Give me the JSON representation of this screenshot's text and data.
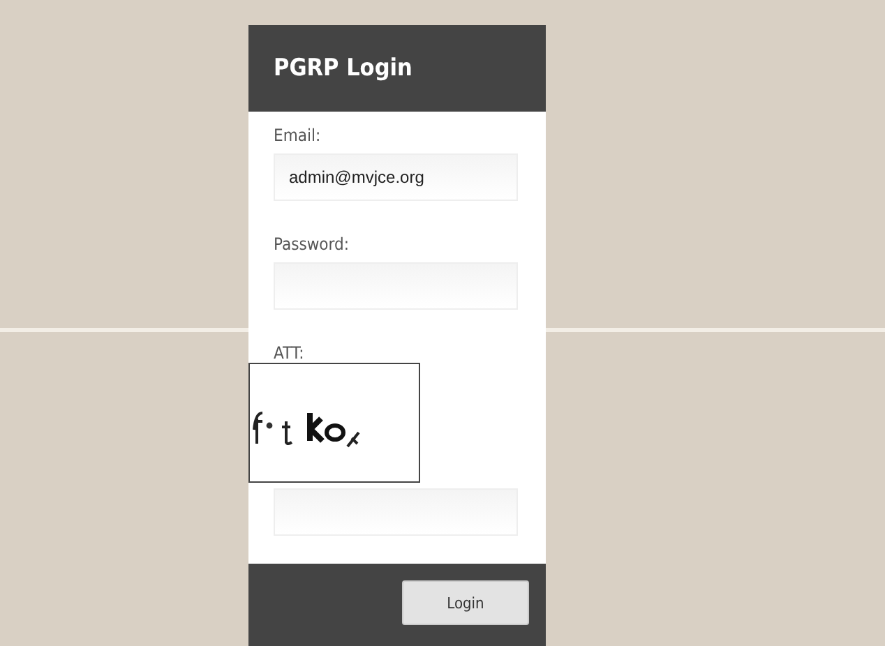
{
  "header": {
    "title": "PGRP Login"
  },
  "fields": [
    {
      "label": "Email:",
      "value": "admin@mvjce.org"
    },
    {
      "label": "Password:"
    }
  ],
  "captcha": {
    "label": "ATT:"
  },
  "buttons": [
    {
      "label": "Login"
    }
  ]
}
